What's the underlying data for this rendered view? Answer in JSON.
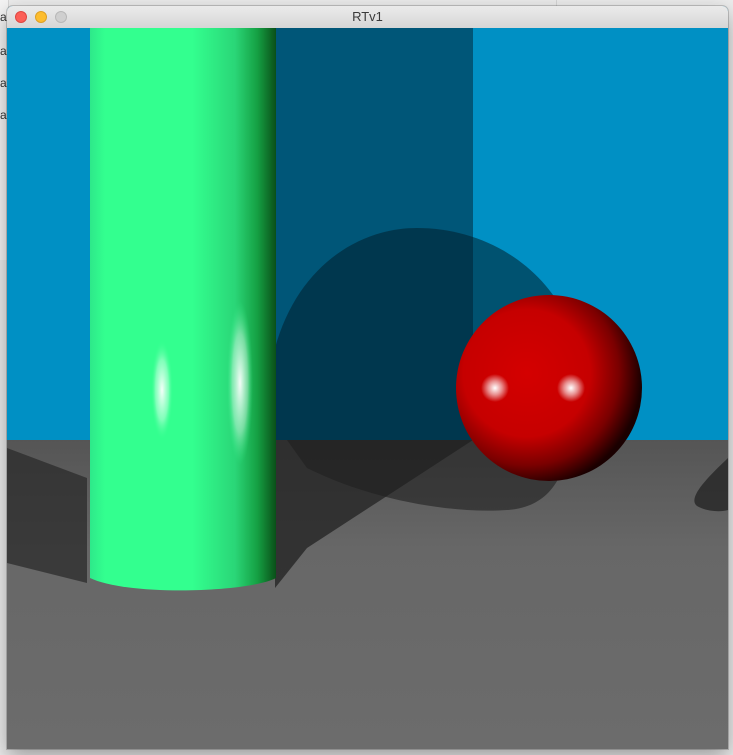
{
  "window": {
    "title": "RTv1"
  },
  "background_app": {
    "side_labels": [
      "al",
      "al",
      "al",
      "al"
    ]
  },
  "scene": {
    "wall_color": "#0090c4",
    "floor_color": "#6b6b6b",
    "cylinder_color": "#33ff8f",
    "sphere_color": "#cc0000"
  }
}
